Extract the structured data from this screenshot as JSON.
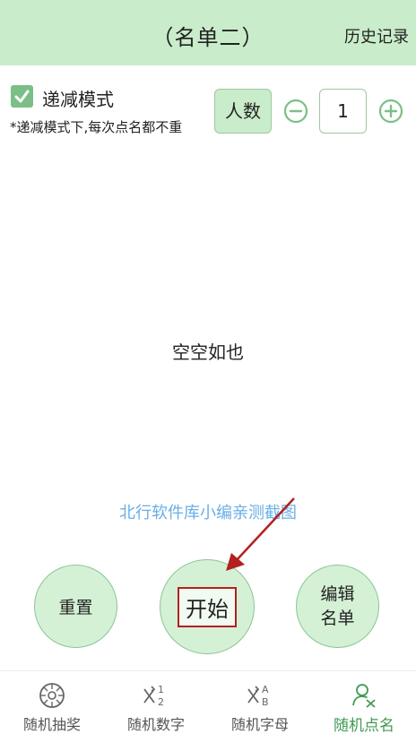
{
  "header": {
    "title": "（名单二）",
    "history_label": "历史记录"
  },
  "mode": {
    "checked": true,
    "label": "递减模式",
    "hint": "*递减模式下,每次点名都不重"
  },
  "count": {
    "button_label": "人数",
    "value": "1"
  },
  "main": {
    "empty_text": "空空如也",
    "watermark": "北行软件库小编亲测截图"
  },
  "actions": {
    "reset_label": "重置",
    "start_label": "开始",
    "edit_line1": "编辑",
    "edit_line2": "名单"
  },
  "tabs": [
    {
      "label": "随机抽奖",
      "icon": "wheel-icon",
      "active": false
    },
    {
      "label": "随机数字",
      "icon": "random-number-icon",
      "active": false
    },
    {
      "label": "随机字母",
      "icon": "random-letter-icon",
      "active": false
    },
    {
      "label": "随机点名",
      "icon": "roll-call-icon",
      "active": true
    }
  ],
  "colors": {
    "header_bg": "#c9ecca",
    "accent": "#3f9a52",
    "watermark": "#6aaee6",
    "annotation": "#b32020"
  }
}
